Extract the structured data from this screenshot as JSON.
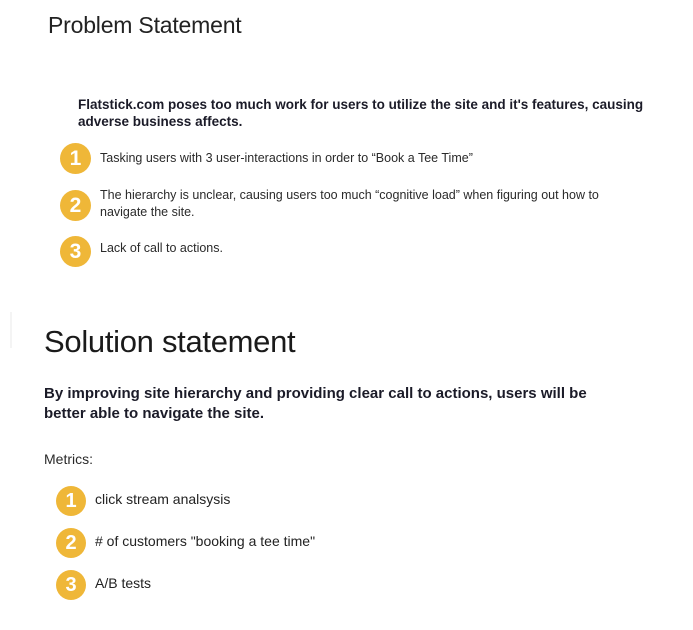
{
  "problem": {
    "title": "Problem Statement",
    "lead": "Flatstick.com poses too much work for users to utilize the site and it's features, causing adverse business affects.",
    "items": [
      {
        "number": "1",
        "text": "Tasking users with 3 user-interactions in order to “Book a Tee Time”"
      },
      {
        "number": "2",
        "text": "The hierarchy is unclear, causing users too much “cognitive load”  when figuring out how to navigate the site."
      },
      {
        "number": "3",
        "text": "Lack of call to actions."
      }
    ]
  },
  "solution": {
    "title": "Solution statement",
    "lead": "By improving site hierarchy and providing clear call to actions, users will be better able to navigate the site.",
    "metrics_label": "Metrics:",
    "metrics": [
      {
        "number": "1",
        "text": "click stream analsysis"
      },
      {
        "number": "2",
        "text": "# of customers \"booking a tee time\""
      },
      {
        "number": "3",
        "text": "A/B tests"
      }
    ]
  },
  "colors": {
    "badge": "#efb738",
    "heading": "#1b1b28"
  }
}
